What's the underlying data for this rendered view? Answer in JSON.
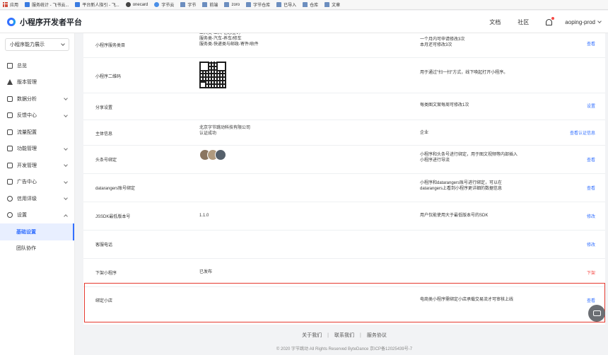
{
  "bookmarks": [
    {
      "label": "应用",
      "icon": "apps-icon"
    },
    {
      "label": "服务统计 - 飞书云...",
      "icon": "doc-icon"
    },
    {
      "label": "平台新人指引 - 飞...",
      "icon": "doc-icon"
    },
    {
      "label": "onecard",
      "icon": "globe-icon"
    },
    {
      "label": "字节云",
      "icon": "cloud-icon"
    },
    {
      "label": "字节",
      "icon": "folder-icon"
    },
    {
      "label": "前端",
      "icon": "folder-icon"
    },
    {
      "label": "zoro",
      "icon": "folder-icon"
    },
    {
      "label": "字节仓库",
      "icon": "folder-icon"
    },
    {
      "label": "已导入",
      "icon": "folder-icon"
    },
    {
      "label": "仓库",
      "icon": "folder-icon"
    },
    {
      "label": "文章",
      "icon": "folder-icon"
    }
  ],
  "header": {
    "title": "小程序开发者平台",
    "docs": "文档",
    "community": "社区",
    "username": "aoping-prod"
  },
  "sidebar": {
    "select": "小程序能力展示",
    "items": [
      {
        "label": "总览",
        "icon": "home-icon",
        "chevron": false
      },
      {
        "label": "版本管理",
        "icon": "alert-icon",
        "chevron": false
      },
      {
        "label": "数据分析",
        "icon": "chart-icon",
        "chevron": true
      },
      {
        "label": "反馈中心",
        "icon": "message-icon",
        "chevron": true
      },
      {
        "label": "流量配置",
        "icon": "flow-icon",
        "chevron": false
      },
      {
        "label": "功能管理",
        "icon": "function-icon",
        "chevron": true
      },
      {
        "label": "开发管理",
        "icon": "dev-icon",
        "chevron": true
      },
      {
        "label": "广告中心",
        "icon": "ad-icon",
        "chevron": true
      },
      {
        "label": "信用评级",
        "icon": "credit-icon",
        "chevron": true
      },
      {
        "label": "设置",
        "icon": "settings-icon",
        "chevron": true
      }
    ],
    "sub_items": [
      "基础设置",
      "团队协作"
    ]
  },
  "rows": [
    {
      "label": "小程序服务类目",
      "value": "工具类-工具-信息查询\n服务类-汽车-养车/修车\n服务类-快递类与邮政-寄件/收件",
      "desc": "一个月内可申请修改3次\n本月还可修改3次",
      "action": "查看"
    },
    {
      "label": "小程序二维码",
      "value": "",
      "desc": "用于通过\"扫一扫\"方式，线下唤起打开小程序。",
      "action": ""
    },
    {
      "label": "分享设置",
      "value": "",
      "desc": "每类图文案每周可修改1次",
      "action": "设置"
    },
    {
      "label": "主体信息",
      "value": "北京字节跳动科技有限公司\n认证成功",
      "desc": "企业",
      "action": "查看认证信息"
    },
    {
      "label": "头条号绑定",
      "value": "",
      "desc": "小程序和头条号进行绑定，用于图文视频等内部插入小程序进行导流",
      "action": "查看"
    },
    {
      "label": "datarangers账号绑定",
      "value": "",
      "desc": "小程序和datarangers账号进行绑定，可以在datarangers上看到小程序更详细的数据信息",
      "action": "查看"
    },
    {
      "label": "JSSDK最低版本号",
      "value": "1.1.0",
      "desc": "用户仅能使用大于最低版本号的SDK",
      "action": "修改"
    },
    {
      "label": "客服电话",
      "value": "",
      "desc": "",
      "action": "修改"
    },
    {
      "label": "下架小程序",
      "value": "已发布",
      "desc": "",
      "action": "下架"
    },
    {
      "label": "绑定小店",
      "value": "",
      "desc": "电商类小程序需绑定小店承载交易流才可审核上线",
      "action": "查看"
    }
  ],
  "footer": {
    "about": "关于我们",
    "contact": "联系我们",
    "agreement": "服务协议",
    "copyright": "© 2020 字节跳动 All Rights Reserved ByteDance 京ICP备12025439号-7"
  },
  "colors": {
    "accent": "#3370ff",
    "danger": "#f54a45",
    "highlight": "#e5392f"
  }
}
